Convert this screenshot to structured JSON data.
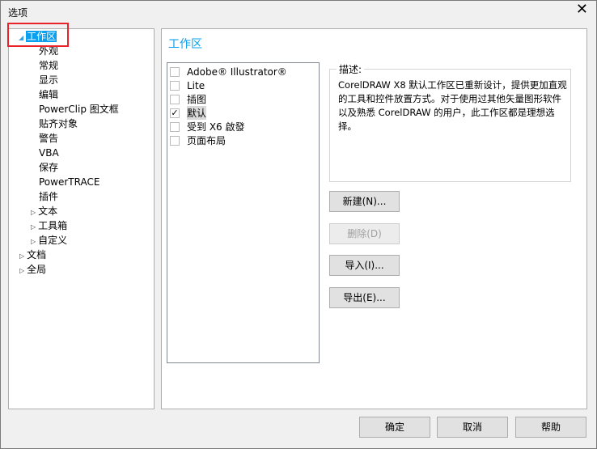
{
  "window": {
    "title": "选项",
    "close": "✕"
  },
  "tree": [
    {
      "label": "工作区",
      "level": 0,
      "expanded": true,
      "selected": true
    },
    {
      "label": "外观",
      "level": 1
    },
    {
      "label": "常规",
      "level": 1
    },
    {
      "label": "显示",
      "level": 1
    },
    {
      "label": "编辑",
      "level": 1
    },
    {
      "label": "PowerClip 图文框",
      "level": 1
    },
    {
      "label": "贴齐对象",
      "level": 1
    },
    {
      "label": "警告",
      "level": 1
    },
    {
      "label": "VBA",
      "level": 1
    },
    {
      "label": "保存",
      "level": 1
    },
    {
      "label": "PowerTRACE",
      "level": 1
    },
    {
      "label": "插件",
      "level": 1
    },
    {
      "label": "文本",
      "level": 1,
      "collapsed": true
    },
    {
      "label": "工具箱",
      "level": 1,
      "collapsed": true
    },
    {
      "label": "自定义",
      "level": 1,
      "collapsed": true
    },
    {
      "label": "文档",
      "level": 0,
      "collapsed": true
    },
    {
      "label": "全局",
      "level": 0,
      "collapsed": true
    }
  ],
  "panel": {
    "title": "工作区",
    "workspaces": [
      {
        "label": "Adobe® Illustrator®",
        "checked": false
      },
      {
        "label": "Lite",
        "checked": false
      },
      {
        "label": "插图",
        "checked": false
      },
      {
        "label": "默认",
        "checked": true
      },
      {
        "label": "受到 X6 啟發",
        "checked": false
      },
      {
        "label": "页面布局",
        "checked": false
      }
    ],
    "desc_label": "描述:",
    "description": "CorelDRAW X8 默认工作区已重新设计，提供更加直观的工具和控件放置方式。对于使用过其他矢量图形软件以及熟悉 CorelDRAW 的用户，此工作区都是理想选择。",
    "buttons": {
      "new": "新建(N)...",
      "delete": "删除(D)",
      "import": "导入(I)...",
      "export": "导出(E)..."
    }
  },
  "footer": {
    "ok": "确定",
    "cancel": "取消",
    "help": "帮助"
  }
}
